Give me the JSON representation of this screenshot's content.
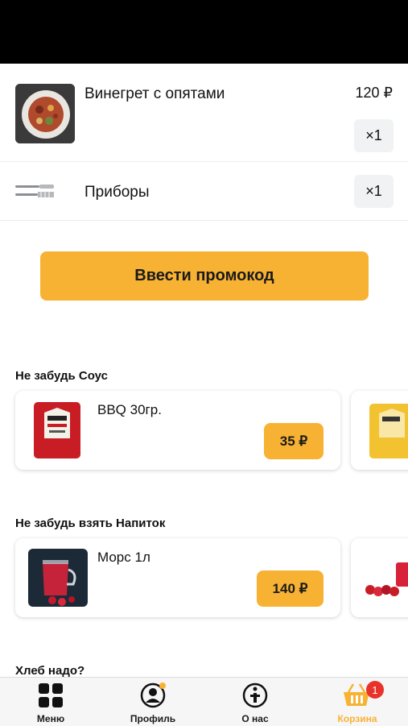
{
  "cart": {
    "items": [
      {
        "name": "Винегрет с опятами",
        "price": "120 ₽",
        "qty": "×1",
        "image_icon": "salad-plate-image"
      },
      {
        "name": "Приборы",
        "qty": "×1",
        "image_icon": "cutlery-icon"
      }
    ]
  },
  "promo": {
    "label": "Ввести промокод"
  },
  "sections": [
    {
      "title": "Не забудь Соус",
      "card": {
        "name": "BBQ 30гр.",
        "price": "35 ₽"
      }
    },
    {
      "title": "Не забудь взять Напиток",
      "card": {
        "name": "Морс 1л",
        "price": "140 ₽"
      }
    },
    {
      "title": "Хлеб надо?"
    }
  ],
  "tabbar": {
    "tabs": [
      {
        "label": "Меню",
        "icon": "grid-icon"
      },
      {
        "label": "Профиль",
        "icon": "profile-icon"
      },
      {
        "label": "О нас",
        "icon": "info-icon"
      },
      {
        "label": "Корзина",
        "icon": "basket-icon",
        "active": true
      }
    ],
    "cart_badge": "1",
    "active_color": "#f8b233"
  },
  "colors": {
    "accent": "#f8b233",
    "badge": "#e8332a"
  }
}
